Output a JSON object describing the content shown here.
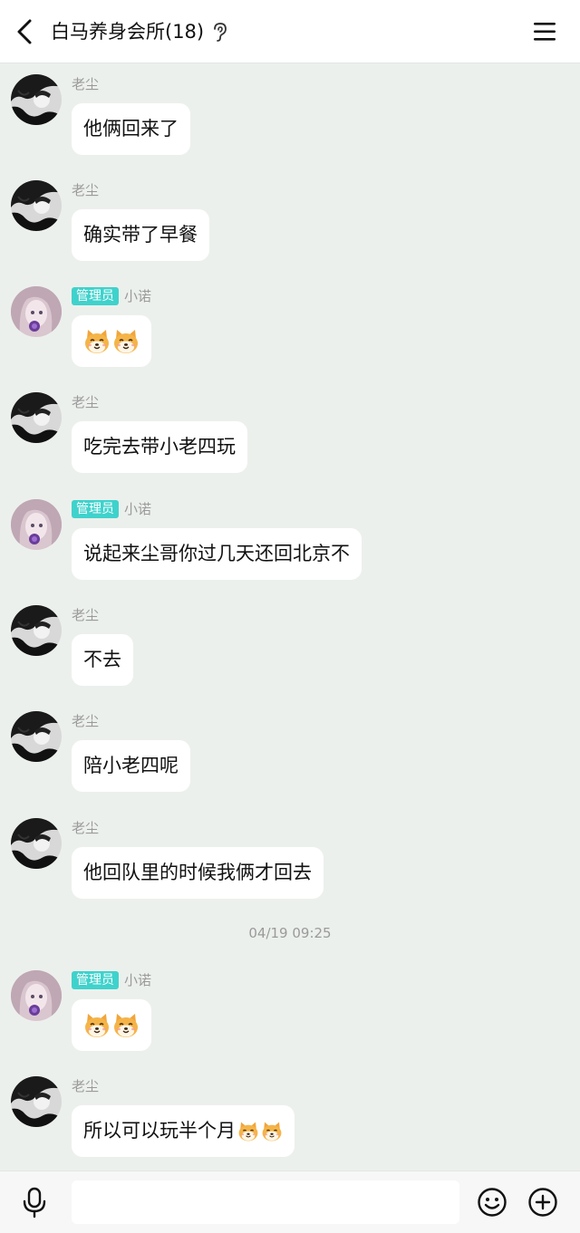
{
  "header": {
    "title": "白马养身会所(18)",
    "back_icon": "chevron-left-icon",
    "ear_icon": "ear-icon",
    "menu_icon": "hamburger-menu-icon"
  },
  "admin_badge": "管理员",
  "messages": [
    {
      "sender": "老尘",
      "text": "他俩回来了"
    },
    {
      "sender": "老尘",
      "text": "确实带了早餐"
    },
    {
      "sender": "小诺",
      "text": "",
      "emoji": [
        "shiba-dog-emoji",
        "shiba-dog-emoji"
      ]
    },
    {
      "sender": "老尘",
      "text": "吃完去带小老四玩"
    },
    {
      "sender": "小诺",
      "text": "说起来尘哥你过几天还回北京不"
    },
    {
      "sender": "老尘",
      "text": "不去"
    },
    {
      "sender": "老尘",
      "text": "陪小老四呢"
    },
    {
      "sender": "老尘",
      "text": "他回队里的时候我俩才回去"
    },
    {
      "sender": "小诺",
      "text": "",
      "emoji": [
        "shiba-dog-emoji",
        "shiba-dog-emoji"
      ]
    },
    {
      "sender": "老尘",
      "text": "所以可以玩半个月",
      "emoji": [
        "shiba-dog-emoji",
        "shiba-dog-emoji"
      ]
    }
  ],
  "timestamp": "04/19 09:25",
  "input": {
    "value": "",
    "placeholder": ""
  },
  "colors": {
    "badge": "#3fd2cc",
    "background": "#ecf0ec",
    "bubble": "#ffffff"
  }
}
